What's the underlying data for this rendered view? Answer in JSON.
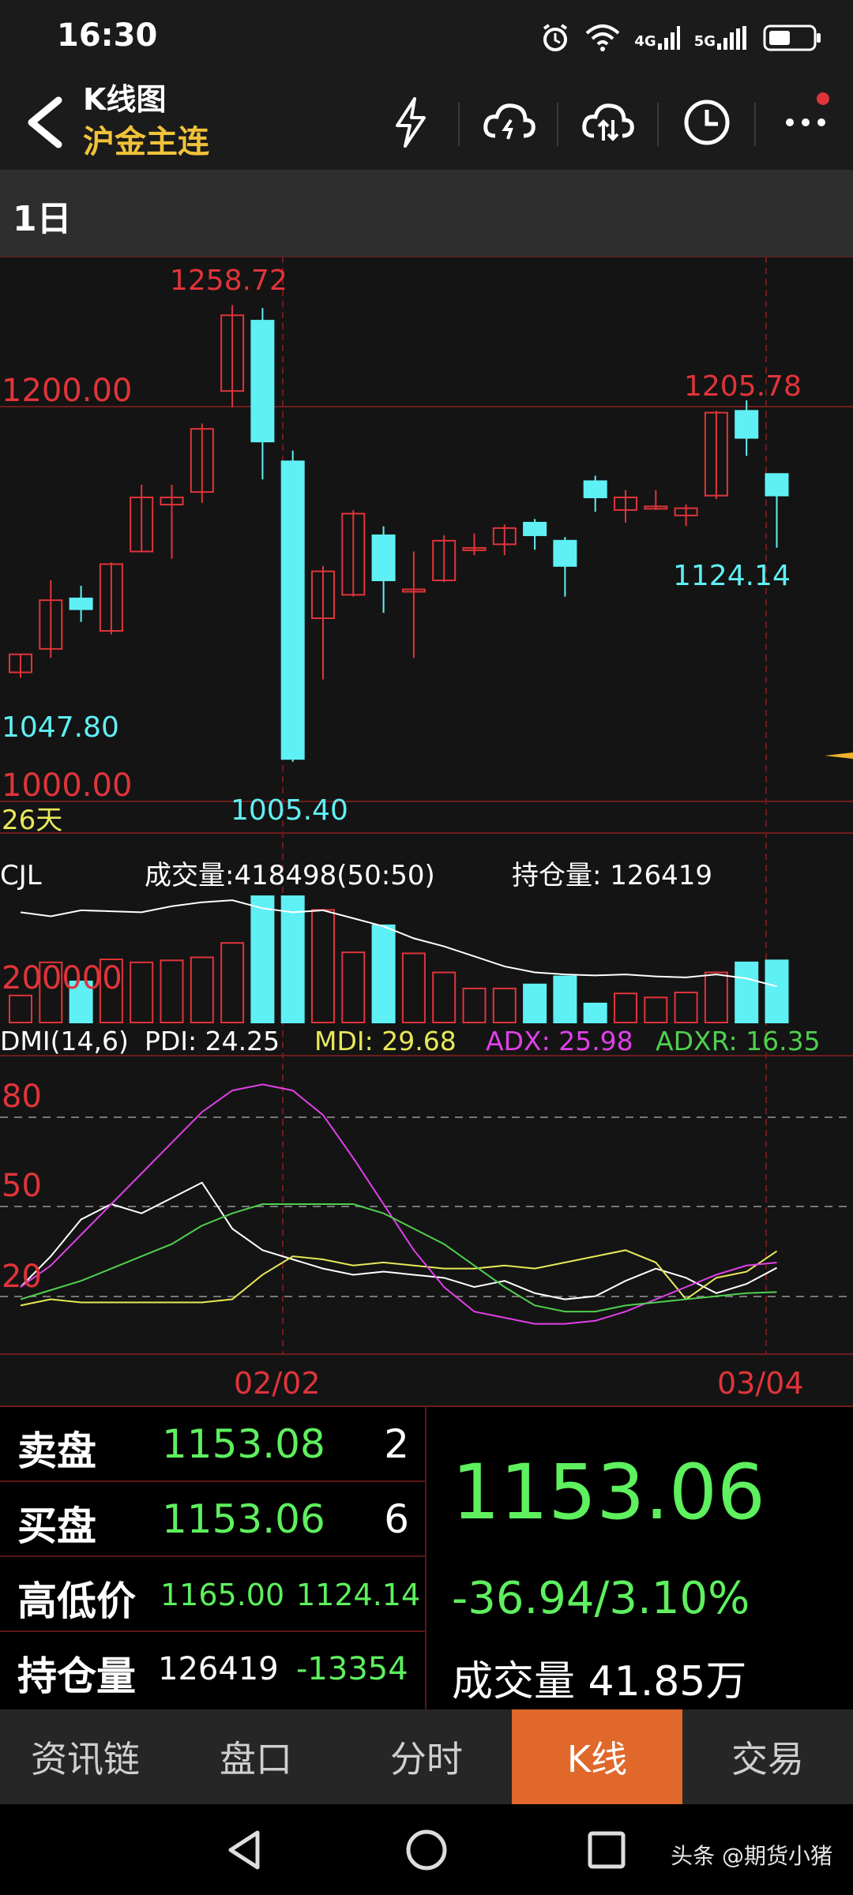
{
  "status": {
    "time": "16:30",
    "network_a": "4G",
    "network_b": "5G"
  },
  "header": {
    "title": "K线图",
    "subtitle": "沪金主连"
  },
  "period": {
    "label": "1日"
  },
  "chart": {
    "price_labels": {
      "high": "1258.72",
      "level_1200": "1200.00",
      "recent_high": "1205.78",
      "recent_low": "1124.14",
      "left_low": "1047.80",
      "level_1000": "1000.00",
      "low": "1005.40",
      "days": "26天"
    },
    "volume": {
      "name": "CJL",
      "volume_text": "成交量:418498(50:50)",
      "oi_text": "持仓量: 126419",
      "axis_label": "200000"
    },
    "dmi": {
      "name": "DMI(14,6)",
      "pdi": "PDI: 24.25",
      "mdi": "MDI: 29.68",
      "adx": "ADX: 25.98",
      "adxr": "ADXR: 16.35",
      "levels": [
        "80",
        "50",
        "20"
      ]
    },
    "dates": {
      "left": "02/02",
      "right": "03/04"
    }
  },
  "chart_data": {
    "type": "candlestick",
    "candles": [
      {
        "o": 1055,
        "c": 1065,
        "h": 1065,
        "l": 1052
      },
      {
        "o": 1068,
        "c": 1095,
        "h": 1106,
        "l": 1063
      },
      {
        "o": 1096,
        "c": 1090,
        "h": 1103,
        "l": 1083
      },
      {
        "o": 1078,
        "c": 1115,
        "h": 1116,
        "l": 1076
      },
      {
        "o": 1122,
        "c": 1152,
        "h": 1159,
        "l": 1122
      },
      {
        "o": 1148,
        "c": 1152,
        "h": 1159,
        "l": 1118
      },
      {
        "o": 1155,
        "c": 1190,
        "h": 1193,
        "l": 1149
      },
      {
        "o": 1211,
        "c": 1253,
        "h": 1258.72,
        "l": 1202
      },
      {
        "o": 1250,
        "c": 1183,
        "h": 1257,
        "l": 1162
      },
      {
        "o": 1172,
        "c": 1007,
        "h": 1178,
        "l": 1005.4
      },
      {
        "o": 1085,
        "c": 1111,
        "h": 1114,
        "l": 1051
      },
      {
        "o": 1098,
        "c": 1143,
        "h": 1145,
        "l": 1097
      },
      {
        "o": 1131,
        "c": 1106,
        "h": 1136,
        "l": 1088
      },
      {
        "o": 1101,
        "c": 1101,
        "h": 1122,
        "l": 1063
      },
      {
        "o": 1106,
        "c": 1128,
        "h": 1131,
        "l": 1105
      },
      {
        "o": 1124,
        "c": 1124,
        "h": 1132,
        "l": 1120
      },
      {
        "o": 1126,
        "c": 1135,
        "h": 1137,
        "l": 1120
      },
      {
        "o": 1138,
        "c": 1131,
        "h": 1140,
        "l": 1123
      },
      {
        "o": 1128,
        "c": 1114,
        "h": 1130,
        "l": 1097
      },
      {
        "o": 1161,
        "c": 1152,
        "h": 1164,
        "l": 1144
      },
      {
        "o": 1145,
        "c": 1152,
        "h": 1156,
        "l": 1138
      },
      {
        "o": 1147,
        "c": 1147,
        "h": 1156,
        "l": 1145
      },
      {
        "o": 1142,
        "c": 1146,
        "h": 1148,
        "l": 1136
      },
      {
        "o": 1153,
        "c": 1199,
        "h": 1200,
        "l": 1151
      },
      {
        "o": 1200,
        "c": 1185,
        "h": 1205.78,
        "l": 1175
      },
      {
        "o": 1165,
        "c": 1153.06,
        "h": 1165,
        "l": 1124.14
      }
    ],
    "price_range": [
      990,
      1268
    ],
    "volume": [
      135000,
      300000,
      205000,
      315000,
      300000,
      310000,
      325000,
      397000,
      630000,
      630000,
      562000,
      350000,
      485000,
      345000,
      250000,
      170000,
      170000,
      190000,
      230000,
      95000,
      145000,
      125000,
      150000,
      250000,
      300000,
      310000
    ],
    "volume_max": 650000,
    "oi_line": [
      550000,
      530000,
      560000,
      555000,
      550000,
      580000,
      600000,
      610000,
      570000,
      550000,
      560000,
      520000,
      480000,
      420000,
      380000,
      330000,
      280000,
      250000,
      240000,
      235000,
      240000,
      230000,
      225000,
      240000,
      220000,
      180000
    ],
    "pdi": [
      18,
      28,
      40,
      45,
      42,
      47,
      52,
      37,
      30,
      27,
      24,
      22,
      23,
      22,
      21,
      18,
      20,
      16,
      14,
      15,
      20,
      24,
      21,
      16,
      19,
      24.25
    ],
    "mdi": [
      12,
      14,
      13,
      13,
      13,
      13,
      13,
      14,
      22,
      28,
      27,
      25,
      26,
      25,
      24,
      24,
      25,
      24,
      26,
      28,
      30,
      26,
      14,
      21,
      23,
      29.68
    ],
    "adx": [
      18,
      25,
      35,
      45,
      55,
      65,
      75,
      82,
      84,
      82,
      74,
      60,
      45,
      30,
      18,
      10,
      8,
      6,
      6,
      7,
      10,
      14,
      18,
      22,
      25,
      25.98
    ],
    "adxr": [
      14,
      17,
      20,
      24,
      28,
      32,
      38,
      42,
      45,
      45,
      45,
      45,
      42,
      37,
      32,
      25,
      18,
      12,
      10,
      10,
      12,
      13,
      14,
      15,
      16,
      16.35
    ],
    "dmi_range": [
      0,
      90
    ]
  },
  "quote": {
    "ask_label": "卖盘",
    "ask_price": "1153.08",
    "ask_vol": "2",
    "bid_label": "买盘",
    "bid_price": "1153.06",
    "bid_vol": "6",
    "hl_label": "高低价",
    "high": "1165.00",
    "low": "1124.14",
    "oi_label": "持仓量",
    "oi": "126419",
    "oi_change": "-13354",
    "last_price": "1153.06",
    "change": "-36.94/3.10%",
    "volume": "成交量 41.85万"
  },
  "tabs": [
    "资讯链",
    "盘口",
    "分时",
    "K线",
    "交易"
  ],
  "active_tab": 3,
  "watermark": "头条 @期货小猪",
  "colors": {
    "up": "#e0343a",
    "down": "#5ff0f5",
    "pdi": "#ffffff",
    "mdi": "#e8e85a",
    "adx": "#e040e8",
    "adxr": "#4fd04f"
  }
}
